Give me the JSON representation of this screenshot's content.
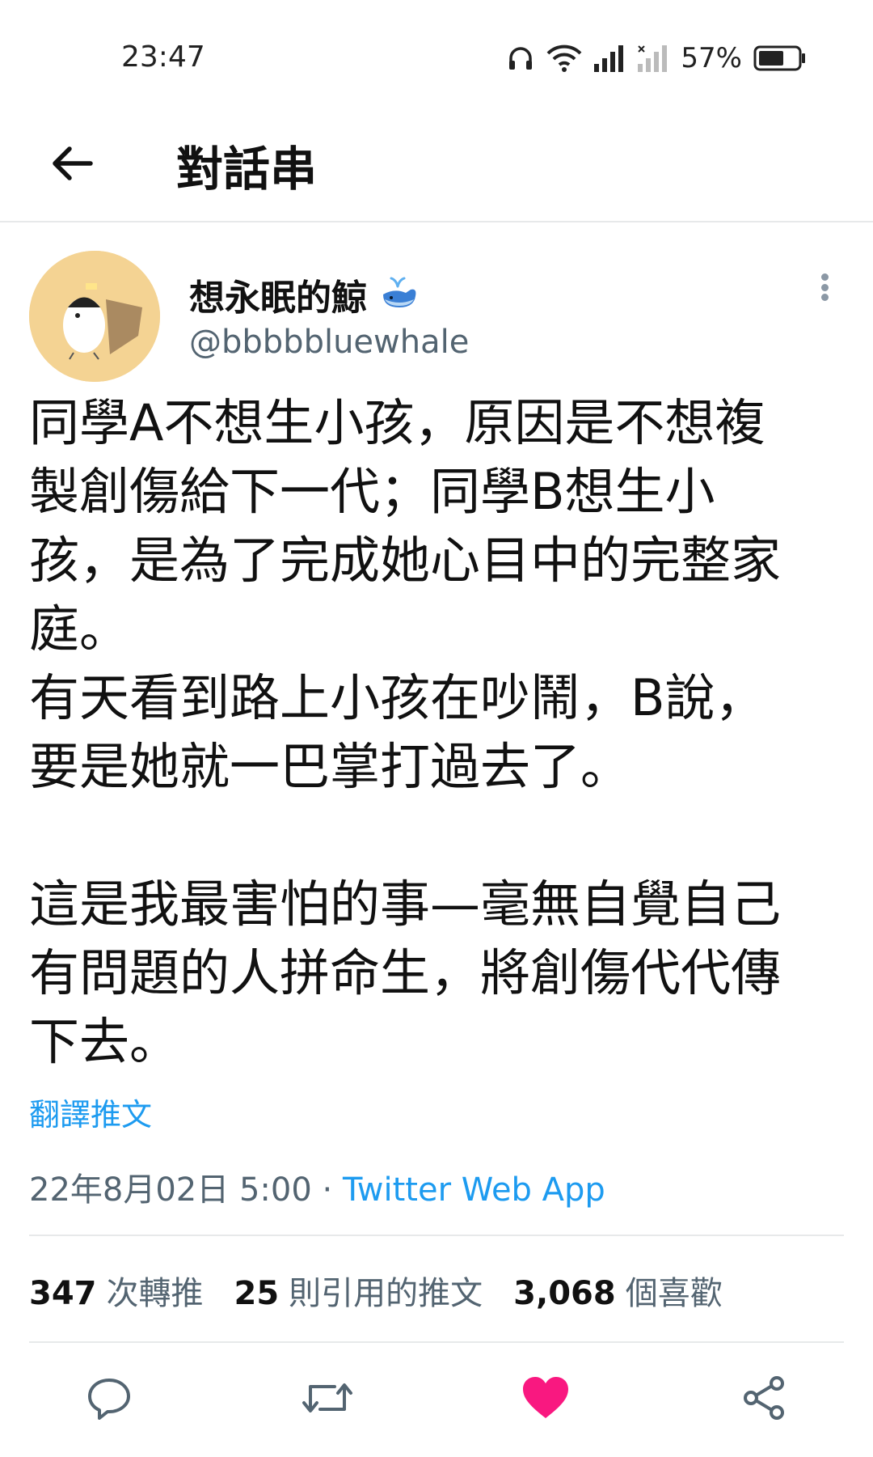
{
  "status_bar": {
    "time": "23:47",
    "battery_percent": "57%",
    "icons": [
      "headphones-icon",
      "wifi-icon",
      "signal-icon",
      "no-signal-icon",
      "battery-icon"
    ]
  },
  "header": {
    "back_icon": "arrow-left-icon",
    "title": "對話串"
  },
  "tweet": {
    "author_name": "想永眠的鯨",
    "author_badge_icon": "whale-emoji-icon",
    "handle": "@bbbbbluewhale",
    "text_lines": [
      "同學A不想生小孩，原因是不想複",
      "製創傷給下一代；同學B想生小",
      "孩，是為了完成她心目中的完整家",
      "庭。",
      "有天看到路上小孩在吵鬧，B說，",
      "要是她就一巴掌打過去了。",
      "",
      "這是我最害怕的事—毫無自覺自己",
      "有問題的人拼命生，將創傷代代傳",
      "下去。"
    ],
    "translate_label": "翻譯推文",
    "timestamp": "22年8月02日 5:00",
    "separator": " · ",
    "source_app": "Twitter Web App",
    "stats": {
      "retweets_count": "347",
      "retweets_label": "次轉推",
      "quotes_count": "25",
      "quotes_label": "則引用的推文",
      "likes_count": "3,068",
      "likes_label": "個喜歡"
    }
  },
  "actions": {
    "icons": [
      "reply-icon",
      "retweet-icon",
      "like-icon",
      "share-icon"
    ],
    "like_color": "#f91880",
    "icon_color": "#536471"
  },
  "colors": {
    "link": "#1d9bf0",
    "secondary_text": "#536471",
    "avatar_bg": "#f4d393"
  }
}
